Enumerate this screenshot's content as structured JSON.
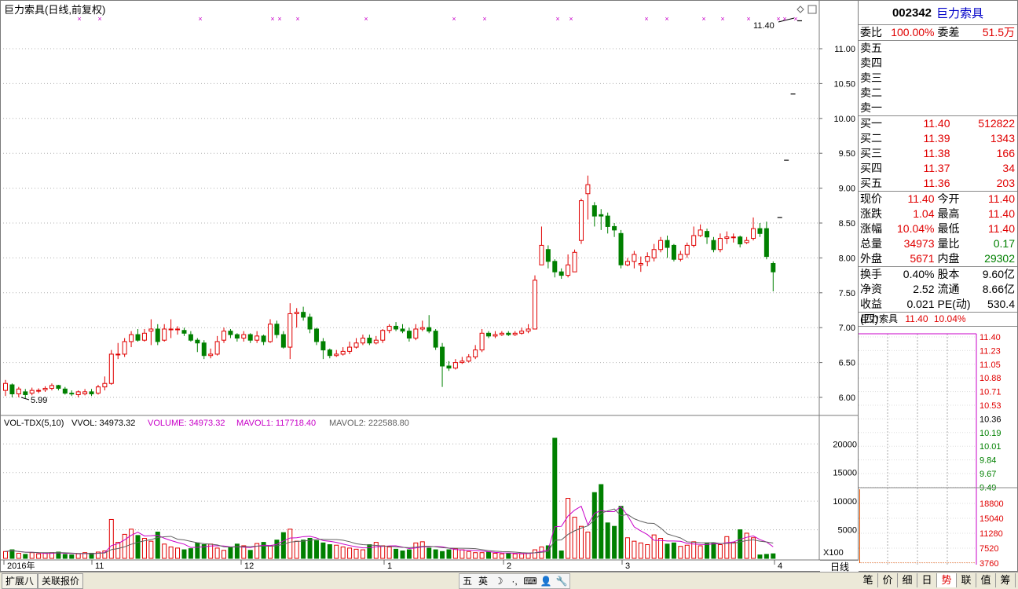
{
  "main": {
    "title": "巨力索具(日线,前复权)",
    "price_axis": [
      "11.00",
      "10.50",
      "10.00",
      "9.50",
      "9.00",
      "8.50",
      "8.00",
      "7.50",
      "7.00",
      "6.50",
      "6.00"
    ],
    "low_marker": "5.99",
    "high_marker": "11.40",
    "vol_axis": [
      "20000",
      "15000",
      "10000",
      "5000"
    ],
    "vol_unit": "X100",
    "period_label": "日线",
    "x_axis_labels": [
      "2016年",
      "11",
      "12",
      "1",
      "2",
      "3",
      "4"
    ],
    "indicator": {
      "name": "VOL-TDX(5,10)",
      "vvol": "VVOL: 34973.32",
      "volume": "VOLUME: 34973.32",
      "mavol1": "MAVOL1: 117718.40",
      "mavol2": "MAVOL2: 222588.80"
    },
    "colors": {
      "up": "#e00000",
      "down": "#008000",
      "ma1": "#c800c8",
      "ma2": "#606060",
      "grid": "#b0b0b0"
    }
  },
  "quote": {
    "code": "002342",
    "name": "巨力索具",
    "weibi_label": "委比",
    "weibi": "100.00%",
    "weicha_label": "委差",
    "weicha": "51.5万",
    "asks": [
      {
        "label": "卖五",
        "price": "",
        "vol": ""
      },
      {
        "label": "卖四",
        "price": "",
        "vol": ""
      },
      {
        "label": "卖三",
        "price": "",
        "vol": ""
      },
      {
        "label": "卖二",
        "price": "",
        "vol": ""
      },
      {
        "label": "卖一",
        "price": "",
        "vol": ""
      }
    ],
    "bids": [
      {
        "label": "买一",
        "price": "11.40",
        "vol": "512822"
      },
      {
        "label": "买二",
        "price": "11.39",
        "vol": "1343"
      },
      {
        "label": "买三",
        "price": "11.38",
        "vol": "166"
      },
      {
        "label": "买四",
        "price": "11.37",
        "vol": "34"
      },
      {
        "label": "买五",
        "price": "11.36",
        "vol": "203"
      }
    ],
    "stats1": [
      {
        "l1": "现价",
        "v1": "11.40",
        "c1": "red",
        "l2": "今开",
        "v2": "11.40",
        "c2": "red"
      },
      {
        "l1": "涨跌",
        "v1": "1.04",
        "c1": "red",
        "l2": "最高",
        "v2": "11.40",
        "c2": "red"
      },
      {
        "l1": "涨幅",
        "v1": "10.04%",
        "c1": "red",
        "l2": "最低",
        "v2": "11.40",
        "c2": "red"
      },
      {
        "l1": "总量",
        "v1": "34973",
        "c1": "red",
        "l2": "量比",
        "v2": "0.17",
        "c2": "grn"
      },
      {
        "l1": "外盘",
        "v1": "5671",
        "c1": "red",
        "l2": "内盘",
        "v2": "29302",
        "c2": "grn"
      }
    ],
    "stats2": [
      {
        "l1": "换手",
        "v1": "0.40%",
        "c1": "blk",
        "l2": "股本",
        "v2": "9.60亿",
        "c2": "blk"
      },
      {
        "l1": "净资",
        "v1": "2.52",
        "c1": "blk",
        "l2": "流通",
        "v2": "8.66亿",
        "c2": "blk"
      },
      {
        "l1": "收益(四)",
        "v1": "0.021",
        "c1": "blk",
        "l2": "PE(动)",
        "v2": "530.4",
        "c2": "blk"
      }
    ]
  },
  "mini": {
    "name": "巨力索具",
    "price": "11.40",
    "pct": "10.04%",
    "price_ticks": [
      "11.40",
      "11.23",
      "11.05",
      "10.88",
      "10.71",
      "10.53",
      "10.36",
      "10.19",
      "10.01",
      "9.84",
      "9.67",
      "9.49"
    ],
    "vol_ticks": [
      "18800",
      "15040",
      "11280",
      "7520",
      "3760"
    ]
  },
  "bottom": {
    "tab1": "扩展八",
    "tab2": "关联报价",
    "ime": [
      "五",
      "英",
      "☽",
      "·,",
      "⌨",
      "👤",
      "🔧"
    ],
    "right_tabs": [
      "笔",
      "价",
      "细",
      "日",
      "势",
      "联",
      "值",
      "筹"
    ],
    "active_right_tab": "势"
  },
  "chart_data": {
    "type": "candlestick",
    "title": "巨力索具(日线,前复权)",
    "candles": [
      [
        6.1,
        6.2,
        6.25,
        6.02
      ],
      [
        6.18,
        6.05,
        6.2,
        6.0
      ],
      [
        6.05,
        6.12,
        6.15,
        6.0
      ],
      [
        6.08,
        6.04,
        6.12,
        5.99
      ],
      [
        6.06,
        6.1,
        6.14,
        6.03
      ],
      [
        6.1,
        6.1,
        6.13,
        6.06
      ],
      [
        6.11,
        6.13,
        6.16,
        6.08
      ],
      [
        6.13,
        6.17,
        6.2,
        6.1
      ],
      [
        6.17,
        6.13,
        6.18,
        6.1
      ],
      [
        6.12,
        6.06,
        6.15,
        6.04
      ],
      [
        6.06,
        6.05,
        6.1,
        6.02
      ],
      [
        6.04,
        6.08,
        6.1,
        6.0
      ],
      [
        6.05,
        6.08,
        6.12,
        6.03
      ],
      [
        6.08,
        6.05,
        6.12,
        6.02
      ],
      [
        6.06,
        6.15,
        6.18,
        6.04
      ],
      [
        6.15,
        6.2,
        6.3,
        6.1
      ],
      [
        6.2,
        6.62,
        6.68,
        6.18
      ],
      [
        6.62,
        6.62,
        6.78,
        6.55
      ],
      [
        6.62,
        6.8,
        6.85,
        6.58
      ],
      [
        6.8,
        6.9,
        6.95,
        6.72
      ],
      [
        6.9,
        6.82,
        6.98,
        6.8
      ],
      [
        6.82,
        6.92,
        6.98,
        6.8
      ],
      [
        6.95,
        6.98,
        7.12,
        6.75
      ],
      [
        6.98,
        6.8,
        7.05,
        6.75
      ],
      [
        6.82,
        6.98,
        7.05,
        6.8
      ],
      [
        6.98,
        6.98,
        7.12,
        6.85
      ],
      [
        6.98,
        6.98,
        7.02,
        6.9
      ],
      [
        6.96,
        6.92,
        7.0,
        6.88
      ],
      [
        6.9,
        6.82,
        6.95,
        6.8
      ],
      [
        6.82,
        6.78,
        6.85,
        6.65
      ],
      [
        6.78,
        6.6,
        6.82,
        6.55
      ],
      [
        6.6,
        6.62,
        6.7,
        6.56
      ],
      [
        6.62,
        6.8,
        6.88,
        6.6
      ],
      [
        6.82,
        6.95,
        7.0,
        6.78
      ],
      [
        6.95,
        6.9,
        6.98,
        6.85
      ],
      [
        6.9,
        6.85,
        6.92,
        6.8
      ],
      [
        6.85,
        6.9,
        6.95,
        6.8
      ],
      [
        6.9,
        6.82,
        6.92,
        6.78
      ],
      [
        6.82,
        6.88,
        6.95,
        6.78
      ],
      [
        6.88,
        6.8,
        6.9,
        6.75
      ],
      [
        6.8,
        7.05,
        7.12,
        6.78
      ],
      [
        7.05,
        6.9,
        7.1,
        6.85
      ],
      [
        6.9,
        6.72,
        6.95,
        6.7
      ],
      [
        6.72,
        7.2,
        7.35,
        6.55
      ],
      [
        7.2,
        7.22,
        7.28,
        7.0
      ],
      [
        7.22,
        7.15,
        7.3,
        7.1
      ],
      [
        7.15,
        6.98,
        7.2,
        6.92
      ],
      [
        6.98,
        6.8,
        7.0,
        6.75
      ],
      [
        6.8,
        6.68,
        6.85,
        6.55
      ],
      [
        6.68,
        6.6,
        6.7,
        6.56
      ],
      [
        6.6,
        6.62,
        6.68,
        6.58
      ],
      [
        6.62,
        6.66,
        6.72,
        6.6
      ],
      [
        6.66,
        6.72,
        6.8,
        6.62
      ],
      [
        6.72,
        6.78,
        6.85,
        6.7
      ],
      [
        6.78,
        6.85,
        6.9,
        6.75
      ],
      [
        6.85,
        6.78,
        6.9,
        6.75
      ],
      [
        6.78,
        6.82,
        6.88,
        6.76
      ],
      [
        6.82,
        6.96,
        6.98,
        6.78
      ],
      [
        6.96,
        7.02,
        7.05,
        6.92
      ],
      [
        7.02,
        6.98,
        7.08,
        6.95
      ],
      [
        6.98,
        6.95,
        7.05,
        6.92
      ],
      [
        6.95,
        6.85,
        7.0,
        6.8
      ],
      [
        6.85,
        6.98,
        7.05,
        6.82
      ],
      [
        6.98,
        7.0,
        7.1,
        6.95
      ],
      [
        7.0,
        6.95,
        7.18,
        6.92
      ],
      [
        6.95,
        6.72,
        6.98,
        6.68
      ],
      [
        6.72,
        6.45,
        6.78,
        6.15
      ],
      [
        6.45,
        6.42,
        6.52,
        6.38
      ],
      [
        6.42,
        6.5,
        6.55,
        6.4
      ],
      [
        6.5,
        6.52,
        6.58,
        6.48
      ],
      [
        6.52,
        6.58,
        6.62,
        6.5
      ],
      [
        6.58,
        6.68,
        6.75,
        6.55
      ],
      [
        6.68,
        6.92,
        6.98,
        6.65
      ],
      [
        6.92,
        6.88,
        6.95,
        6.85
      ],
      [
        6.88,
        6.9,
        6.95,
        6.85
      ],
      [
        6.9,
        6.92,
        6.95,
        6.88
      ],
      [
        6.92,
        6.9,
        6.95,
        6.88
      ],
      [
        6.9,
        6.92,
        6.95,
        6.88
      ],
      [
        6.92,
        6.95,
        7.0,
        6.9
      ],
      [
        6.95,
        6.98,
        7.05,
        6.92
      ],
      [
        6.98,
        7.68,
        7.75,
        6.98
      ],
      [
        7.9,
        8.18,
        8.45,
        7.95
      ],
      [
        8.12,
        7.95,
        8.18,
        7.85
      ],
      [
        7.95,
        7.8,
        7.98,
        7.72
      ],
      [
        7.8,
        7.75,
        7.85,
        7.7
      ],
      [
        7.75,
        7.9,
        8.05,
        7.72
      ],
      [
        7.8,
        8.08,
        8.12,
        7.8
      ],
      [
        8.25,
        8.82,
        8.85,
        8.2
      ],
      [
        8.92,
        9.05,
        9.18,
        8.55
      ],
      [
        8.75,
        8.6,
        8.8,
        8.45
      ],
      [
        8.62,
        8.6,
        8.7,
        8.4
      ],
      [
        8.6,
        8.45,
        8.65,
        8.35
      ],
      [
        8.45,
        8.4,
        8.5,
        8.3
      ],
      [
        8.35,
        7.9,
        8.4,
        7.85
      ],
      [
        7.9,
        7.95,
        8.0,
        7.88
      ],
      [
        7.95,
        8.05,
        8.1,
        7.85
      ],
      [
        7.9,
        7.92,
        8.02,
        7.8
      ],
      [
        7.95,
        8.02,
        8.08,
        7.88
      ],
      [
        8.0,
        8.12,
        8.2,
        7.95
      ],
      [
        8.12,
        8.25,
        8.3,
        8.08
      ],
      [
        8.25,
        8.15,
        8.32,
        8.0
      ],
      [
        8.18,
        7.98,
        8.2,
        7.95
      ],
      [
        7.98,
        8.05,
        8.1,
        7.95
      ],
      [
        8.05,
        8.18,
        8.22,
        8.0
      ],
      [
        8.18,
        8.32,
        8.45,
        8.15
      ],
      [
        8.32,
        8.4,
        8.48,
        8.3
      ],
      [
        8.38,
        8.3,
        8.42,
        8.2
      ],
      [
        8.25,
        8.12,
        8.3,
        8.08
      ],
      [
        8.12,
        8.28,
        8.35,
        8.08
      ],
      [
        8.28,
        8.3,
        8.38,
        8.2
      ],
      [
        8.3,
        8.3,
        8.35,
        8.22
      ],
      [
        8.3,
        8.2,
        8.32,
        8.15
      ],
      [
        8.22,
        8.25,
        8.3,
        8.2
      ],
      [
        8.28,
        8.42,
        8.58,
        8.25
      ],
      [
        8.42,
        8.35,
        8.5,
        8.3
      ],
      [
        8.42,
        8.02,
        8.52,
        7.98
      ],
      [
        7.92,
        7.8,
        7.95,
        7.52
      ],
      [
        8.58,
        8.58,
        8.58,
        8.58
      ],
      [
        9.4,
        9.4,
        9.4,
        9.4
      ],
      [
        10.35,
        10.35,
        10.35,
        10.35
      ],
      [
        11.4,
        11.4,
        11.4,
        11.4
      ]
    ],
    "volumes": [
      1200,
      1500,
      900,
      700,
      1000,
      800,
      900,
      1000,
      1100,
      700,
      600,
      800,
      1000,
      900,
      1100,
      1300,
      6800,
      2800,
      4200,
      5100,
      4000,
      3500,
      3000,
      4600,
      2500,
      2000,
      1800,
      1500,
      1700,
      2700,
      2400,
      2500,
      1800,
      1400,
      1900,
      2500,
      2200,
      1400,
      2600,
      2800,
      2200,
      3200,
      4500,
      5100,
      3000,
      3200,
      3500,
      3100,
      2700,
      2400,
      2300,
      2000,
      1800,
      1600,
      1500,
      2400,
      2800,
      2200,
      2000,
      1600,
      1300,
      1500,
      2700,
      2900,
      1800,
      1500,
      1200,
      1500,
      1700,
      1500,
      1200,
      1000,
      1000,
      1100,
      900,
      800,
      900,
      800,
      800,
      900,
      1500,
      2000,
      2200,
      21000,
      1300,
      10500,
      7200,
      5600,
      4600,
      11500,
      12900,
      6200,
      5600,
      9100,
      3600,
      3000,
      2700,
      2400,
      4100,
      3500,
      2500,
      2700,
      2100,
      2300,
      2900,
      2200,
      2600,
      2700,
      2400,
      3800,
      2800,
      5000,
      4400,
      3600,
      600,
      700,
      800
    ],
    "ylim": [
      5.8,
      11.5
    ],
    "xlabels": [
      "2016年",
      "11",
      "12",
      "1",
      "2",
      "3",
      "4"
    ]
  }
}
